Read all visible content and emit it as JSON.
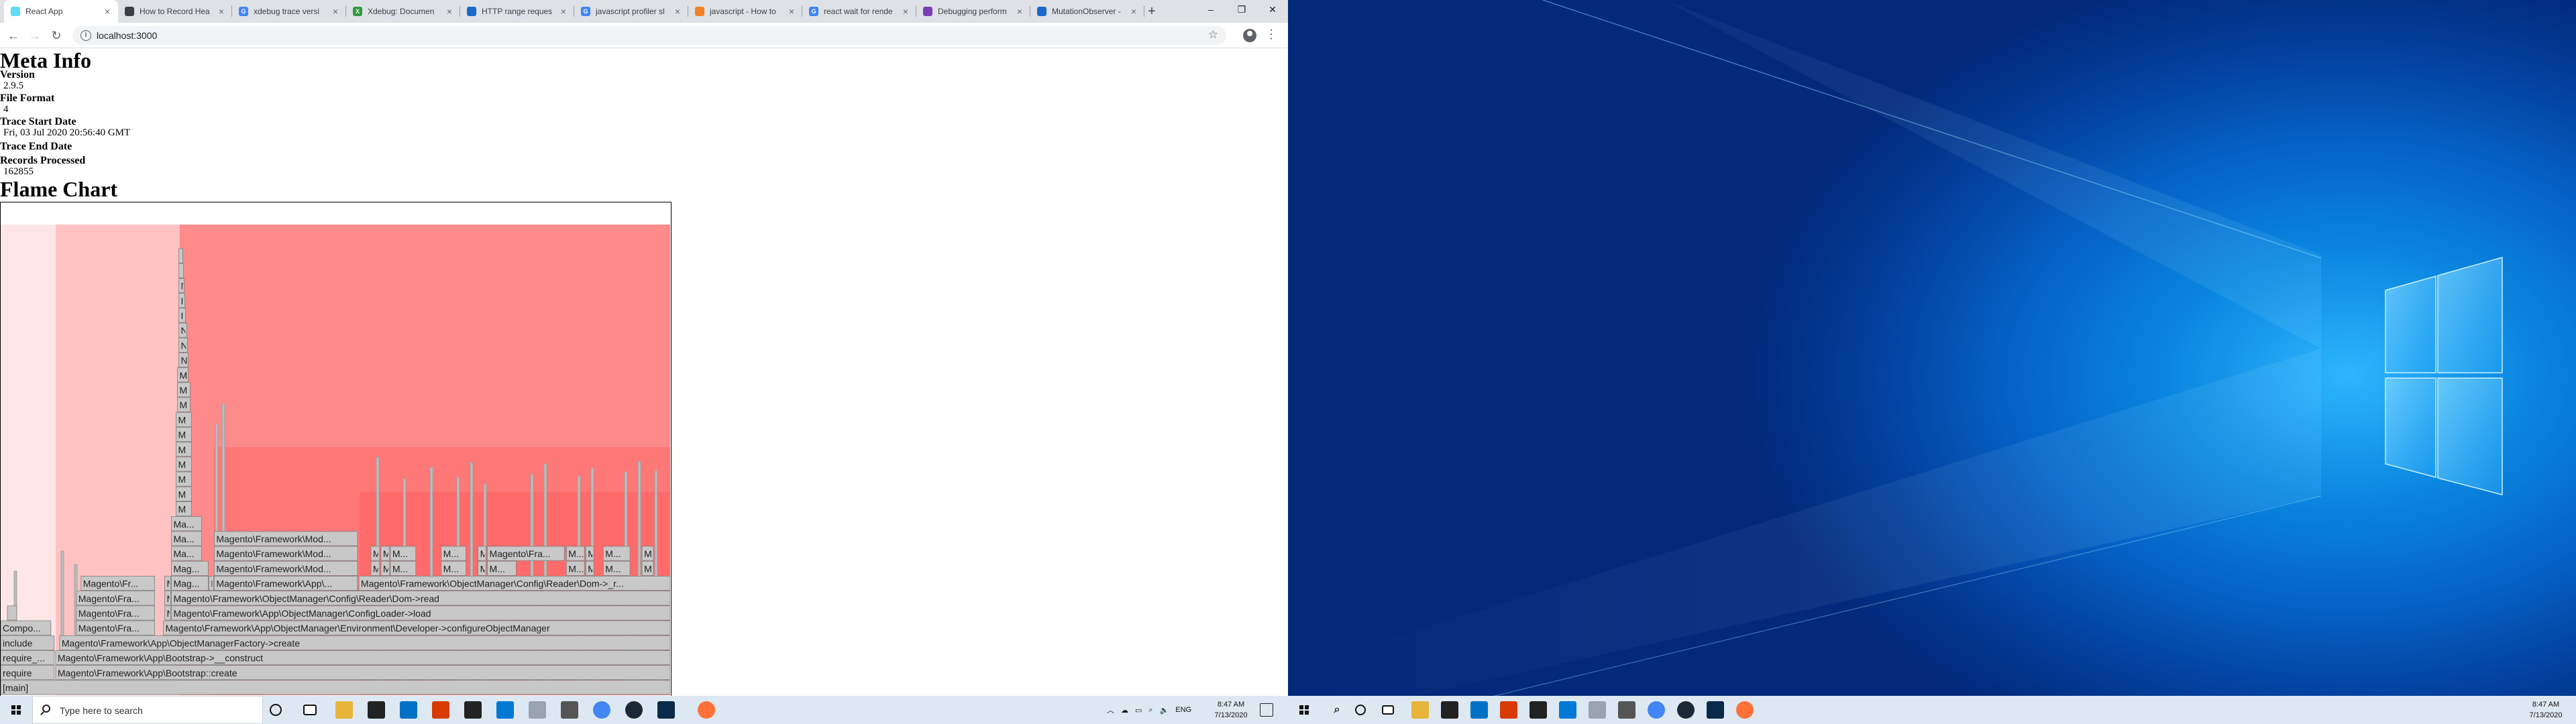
{
  "browser": {
    "tabs": [
      {
        "title": "React App",
        "fav_color": "#61dafb",
        "fav_text": "",
        "active": true
      },
      {
        "title": "How to Record Hea",
        "fav_color": "#3c4043",
        "fav_text": "",
        "active": false
      },
      {
        "title": "xdebug trace versi",
        "fav_color": "#4285f4",
        "fav_text": "G",
        "active": false
      },
      {
        "title": "Xdebug: Documen",
        "fav_color": "#2e9b3e",
        "fav_text": "X",
        "active": false
      },
      {
        "title": "HTTP range reques",
        "fav_color": "#1b6ac9",
        "fav_text": "",
        "active": false
      },
      {
        "title": "javascript profiler sl",
        "fav_color": "#4285f4",
        "fav_text": "G",
        "active": false
      },
      {
        "title": "javascript - How to",
        "fav_color": "#f48024",
        "fav_text": "",
        "active": false
      },
      {
        "title": "react wait for rende",
        "fav_color": "#4285f4",
        "fav_text": "G",
        "active": false
      },
      {
        "title": "Debugging perform",
        "fav_color": "#7b3fb5",
        "fav_text": "",
        "active": false
      },
      {
        "title": "MutationObserver -",
        "fav_color": "#1b6ac9",
        "fav_text": "",
        "active": false
      }
    ],
    "new_tab": "+",
    "url": "localhost:3000",
    "window_controls": [
      "–",
      "❐",
      "✕"
    ]
  },
  "page": {
    "meta_title": "Meta Info",
    "fields": [
      {
        "label": "Version",
        "value": "2.9.5"
      },
      {
        "label": "File Format",
        "value": "4"
      },
      {
        "label": "Trace Start Date",
        "value": "Fri, 03 Jul 2020 20:56:40 GMT"
      },
      {
        "label": "Trace End Date",
        "value": ""
      },
      {
        "label": "Records Processed",
        "value": "162855"
      }
    ],
    "flame_title": "Flame Chart"
  },
  "flame": {
    "fill_colors": [
      "#ffe6e6",
      "#ffc2c2",
      "#ff9c9c",
      "#ff8a8a",
      "#ff7878",
      "#ff6b6b"
    ],
    "block_grey": "#c8c8c8",
    "rows": [
      [
        {
          "label": "[main]",
          "start": 0,
          "end": 1
        }
      ],
      [
        {
          "label": "require",
          "start": 0,
          "end": 0.08
        },
        {
          "label": "Magento\\Framework\\App\\Bootstrap::create",
          "start": 0.082,
          "end": 1
        }
      ],
      [
        {
          "label": "require_...",
          "start": 0,
          "end": 0.08
        },
        {
          "label": "Magento\\Framework\\App\\Bootstrap->__construct",
          "start": 0.082,
          "end": 1
        }
      ],
      [
        {
          "label": "include",
          "start": 0,
          "end": 0.08
        },
        {
          "label": "Magento\\Framework\\App\\ObjectManagerFactory->create",
          "start": 0.088,
          "end": 1
        }
      ],
      [
        {
          "label": "Compo...",
          "start": 0,
          "end": 0.075
        },
        {
          "label": "Magento\\Fra...",
          "start": 0.113,
          "end": 0.23
        },
        {
          "label": "Magento\\Framework\\App\\ObjectManager\\Environment\\Developer->configureObjectManager",
          "start": 0.243,
          "end": 1
        }
      ],
      [
        {
          "label": "",
          "start": 0.01,
          "end": 0.024
        },
        {
          "label": "Magento\\Fra...",
          "start": 0.113,
          "end": 0.23
        },
        {
          "label": "M",
          "start": 0.245,
          "end": 0.254
        },
        {
          "label": "Magento\\Framework\\App\\ObjectManager\\ConfigLoader->load",
          "start": 0.255,
          "end": 1
        }
      ],
      [
        {
          "label": "Magento\\Fra...",
          "start": 0.113,
          "end": 0.23
        },
        {
          "label": "M",
          "start": 0.245,
          "end": 0.254
        },
        {
          "label": "Magento\\Framework\\ObjectManager\\Config\\Reader\\Dom->read",
          "start": 0.255,
          "end": 1
        }
      ],
      [
        {
          "label": "Magento\\Fr...",
          "start": 0.12,
          "end": 0.23
        },
        {
          "label": "M",
          "start": 0.245,
          "end": 0.254
        },
        {
          "label": "Mag...",
          "start": 0.255,
          "end": 0.31
        },
        {
          "label": "M",
          "start": 0.311,
          "end": 0.318
        },
        {
          "label": "Magento\\Framework\\App\\...",
          "start": 0.319,
          "end": 0.533
        },
        {
          "label": "Magento\\Framework\\ObjectManager\\Config\\Reader\\Dom->_r...",
          "start": 0.535,
          "end": 1
        }
      ],
      [
        {
          "label": "Mag...",
          "start": 0.255,
          "end": 0.31
        },
        {
          "label": "Magento\\Framework\\Mod...",
          "start": 0.319,
          "end": 0.533
        },
        {
          "label": "M",
          "start": 0.553,
          "end": 0.566
        },
        {
          "label": "M",
          "start": 0.568,
          "end": 0.581
        },
        {
          "label": "M...",
          "start": 0.582,
          "end": 0.62
        },
        {
          "label": "M...",
          "start": 0.658,
          "end": 0.695
        },
        {
          "label": "M",
          "start": 0.713,
          "end": 0.725
        },
        {
          "label": "M...",
          "start": 0.727,
          "end": 0.77
        },
        {
          "label": "M...",
          "start": 0.845,
          "end": 0.872
        },
        {
          "label": "M",
          "start": 0.874,
          "end": 0.886
        },
        {
          "label": "M...",
          "start": 0.9,
          "end": 0.94
        },
        {
          "label": "M",
          "start": 0.958,
          "end": 0.975
        }
      ],
      [
        {
          "label": "Ma...",
          "start": 0.255,
          "end": 0.3
        },
        {
          "label": "Magento\\Framework\\Mod...",
          "start": 0.319,
          "end": 0.533
        },
        {
          "label": "M",
          "start": 0.553,
          "end": 0.566
        },
        {
          "label": "M",
          "start": 0.568,
          "end": 0.581
        },
        {
          "label": "M...",
          "start": 0.582,
          "end": 0.62
        },
        {
          "label": "M...",
          "start": 0.658,
          "end": 0.695
        },
        {
          "label": "M",
          "start": 0.713,
          "end": 0.725
        },
        {
          "label": "Magento\\Fra...",
          "start": 0.727,
          "end": 0.842
        },
        {
          "label": "M...",
          "start": 0.845,
          "end": 0.872
        },
        {
          "label": "M",
          "start": 0.874,
          "end": 0.886
        },
        {
          "label": "M...",
          "start": 0.9,
          "end": 0.94
        },
        {
          "label": "M",
          "start": 0.958,
          "end": 0.975
        }
      ],
      [
        {
          "label": "Ma...",
          "start": 0.255,
          "end": 0.3
        },
        {
          "label": "Magento\\Framework\\Mod...",
          "start": 0.319,
          "end": 0.533
        }
      ],
      [
        {
          "label": "Ma...",
          "start": 0.255,
          "end": 0.3
        }
      ],
      [
        {
          "label": "M",
          "start": 0.262,
          "end": 0.285
        }
      ],
      [
        {
          "label": "M",
          "start": 0.262,
          "end": 0.285
        }
      ],
      [
        {
          "label": "M",
          "start": 0.262,
          "end": 0.285
        }
      ],
      [
        {
          "label": "M",
          "start": 0.262,
          "end": 0.285
        }
      ],
      [
        {
          "label": "M",
          "start": 0.262,
          "end": 0.285
        }
      ],
      [
        {
          "label": "M",
          "start": 0.262,
          "end": 0.285
        }
      ],
      [
        {
          "label": "M",
          "start": 0.262,
          "end": 0.285
        }
      ],
      [
        {
          "label": "M",
          "start": 0.264,
          "end": 0.283
        }
      ],
      [
        {
          "label": "M",
          "start": 0.264,
          "end": 0.283
        }
      ],
      [
        {
          "label": "M",
          "start": 0.264,
          "end": 0.28
        }
      ],
      [
        {
          "label": "N",
          "start": 0.266,
          "end": 0.28
        }
      ],
      [
        {
          "label": "N",
          "start": 0.266,
          "end": 0.279
        }
      ],
      [
        {
          "label": "N",
          "start": 0.266,
          "end": 0.278
        }
      ],
      [
        {
          "label": "I",
          "start": 0.266,
          "end": 0.276
        }
      ],
      [
        {
          "label": "I",
          "start": 0.266,
          "end": 0.275
        }
      ],
      [
        {
          "label": "N",
          "start": 0.266,
          "end": 0.274
        }
      ],
      [
        {
          "label": "",
          "start": 0.266,
          "end": 0.273
        }
      ],
      [
        {
          "label": "",
          "start": 0.266,
          "end": 0.272
        }
      ]
    ]
  },
  "taskbar": {
    "search_placeholder": "Type here to search",
    "lang": "ENG",
    "time": "8:47 AM",
    "date": "7/13/2020"
  }
}
